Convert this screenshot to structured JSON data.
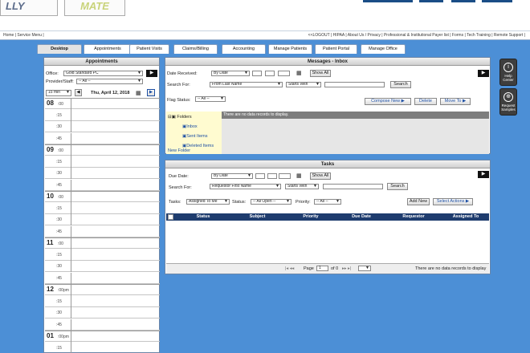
{
  "header": {
    "logo_left": "LLY",
    "logo_right": "MATE"
  },
  "topnav": {
    "left": "Home  |  Service Menu  |",
    "right": "<<LOGOUT  |  HIPAA  |  About Us / Privacy  |  Professional & Institutional Payer list  |  Forms  |  Tech Training  |  Remote Support  |"
  },
  "tabs": [
    "Desktop",
    "Appointments",
    "Patient Visits",
    "Claims/Billing",
    "Accounting",
    "Manage Patients",
    "Patient Portal",
    "Manage Office"
  ],
  "appointments": {
    "title": "Appointments",
    "office_label": "Office:",
    "office_value": "Gold Standard PC",
    "provider_label": "Provider/Staff:",
    "provider_value": "-- All --",
    "interval": "15 min",
    "date": "Thu, April 12, 2018",
    "slots": [
      {
        "hour": "08",
        "min": ":00"
      },
      {
        "min": ":15"
      },
      {
        "min": ":30"
      },
      {
        "min": ":45"
      },
      {
        "hour": "09",
        "min": ":00"
      },
      {
        "min": ":15"
      },
      {
        "min": ":30"
      },
      {
        "min": ":45"
      },
      {
        "hour": "10",
        "min": ":00"
      },
      {
        "min": ":15"
      },
      {
        "min": ":30"
      },
      {
        "min": ":45"
      },
      {
        "hour": "11",
        "min": ":00"
      },
      {
        "min": ":15"
      },
      {
        "min": ":30"
      },
      {
        "min": ":45"
      },
      {
        "hour": "12",
        "min": ":00pm"
      },
      {
        "min": ":15"
      },
      {
        "min": ":30"
      },
      {
        "min": ":45"
      },
      {
        "hour": "01",
        "min": ":00pm"
      },
      {
        "min": ":15"
      }
    ]
  },
  "messages": {
    "title": "Messages - Inbox",
    "date_received_label": "Date Received:",
    "date_received_value": "By Date",
    "show_all": "Show All",
    "search_for_label": "Search For:",
    "search_field": "From Last Name",
    "search_op": "Starts With",
    "search_button": "Search",
    "flag_status_label": "Flag Status:",
    "flag_status_value": "-- All --",
    "compose": "Compose New",
    "delete": "Delete",
    "move_to": "Move To",
    "folders": [
      "Folders",
      "Inbox",
      "Sent Items",
      "Deleted Items"
    ],
    "new_folder": "New Folder",
    "no_records": "There are no data records to display."
  },
  "tasks": {
    "title": "Tasks",
    "due_date_label": "Due Date:",
    "due_date_value": "By Date",
    "show_all": "Show All",
    "search_for_label": "Search For:",
    "search_field": "Requestor First Name",
    "search_op": "Starts With",
    "search_button": "Search",
    "tasks_label": "Tasks:",
    "tasks_value": "Assigned To Me",
    "status_label": "Status:",
    "status_value": "-- All Open --",
    "priority_label": "Priority:",
    "priority_value": "-- All --",
    "add_new": "Add New",
    "select_actions": "Select Actions",
    "columns": [
      "Status",
      "Subject",
      "Priority",
      "Due Date",
      "Requestor",
      "Assigned To"
    ],
    "pager": {
      "page_label": "Page",
      "page_value": "1",
      "of_label": "of 0"
    },
    "no_records": "There are no data records to display"
  },
  "side": {
    "help": "Help Center",
    "samples": "Request Samples"
  }
}
